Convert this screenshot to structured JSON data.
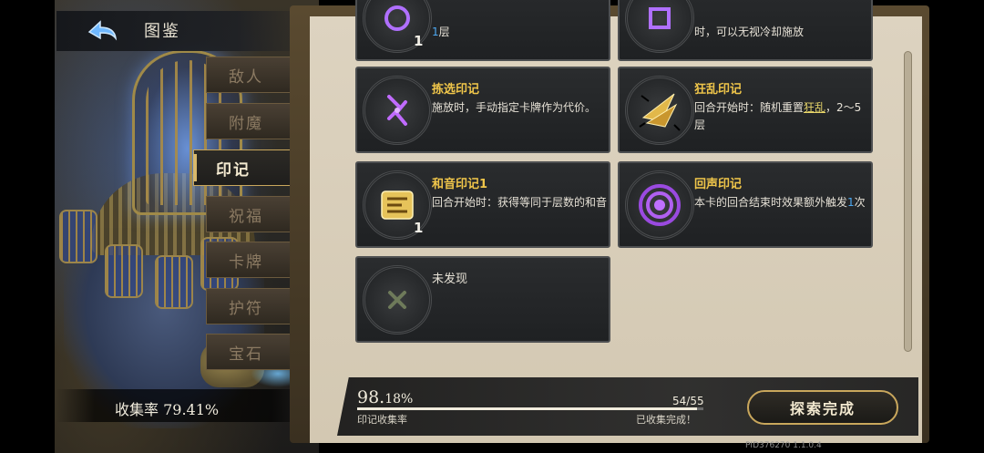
{
  "header": {
    "title": "图鉴"
  },
  "tabs": [
    {
      "label": "敌人",
      "active": false
    },
    {
      "label": "附魔",
      "active": false
    },
    {
      "label": "印记",
      "active": true
    },
    {
      "label": "祝福",
      "active": false
    },
    {
      "label": "卡牌",
      "active": false
    },
    {
      "label": "护符",
      "active": false
    },
    {
      "label": "宝石",
      "active": false
    }
  ],
  "collection": {
    "label": "收集率 79.41%"
  },
  "cards": {
    "top_left": {
      "count": "1",
      "desc_prefix": "",
      "desc_num": "1",
      "desc_suffix": "层"
    },
    "top_right": {
      "desc": "时，可以无视冷却施放"
    },
    "pick": {
      "name": "拣选印记",
      "desc": "施放时，手动指定卡牌作为代价。"
    },
    "frenzy": {
      "name": "狂乱印记",
      "desc_prefix": "回合开始时：随机重置",
      "keyword": "狂乱",
      "desc_suffix": "，2～5层"
    },
    "harmony": {
      "name": "和音印记1",
      "count": "1",
      "desc": "回合开始时：获得等同于层数的和音"
    },
    "echo": {
      "name": "回声印记",
      "desc_prefix": "本卡的回合结束时效果额外触发",
      "desc_num": "1",
      "desc_suffix": "次"
    },
    "undiscovered": {
      "name": "未发现"
    }
  },
  "progress": {
    "percent_int": "98.",
    "percent_dec": "18%",
    "value": 0.9818,
    "count": "54/55",
    "label": "印记收集率",
    "status": "已收集完成！"
  },
  "explore_button": "探索完成",
  "version": "PID376270  1.1.0.4",
  "colors": {
    "gold": "#f0c64a",
    "accent_blue": "#4da8f0",
    "keyword": "#e8d66a"
  },
  "icons": [
    "back-arrow-icon",
    "pick-rune-icon",
    "frenzy-blades-icon",
    "harmony-icon",
    "echo-icon",
    "undiscovered-icon"
  ]
}
